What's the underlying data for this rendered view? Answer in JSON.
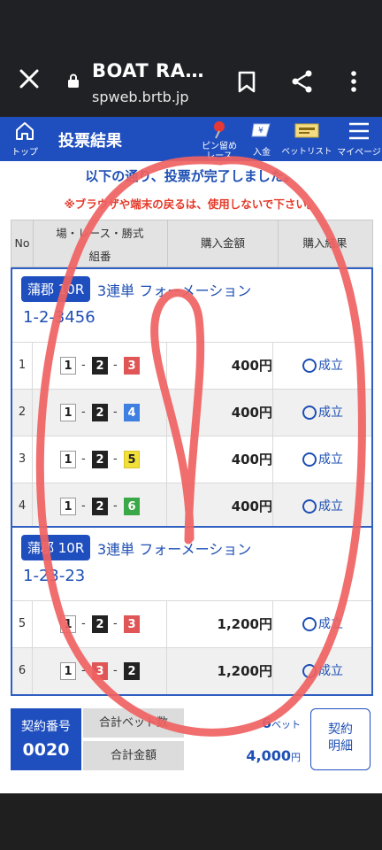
{
  "browser": {
    "title": "BOAT RA…",
    "url": "spweb.brtb.jp"
  },
  "nav": {
    "top_label": "トップ",
    "page_title": "投票結果",
    "pin_label_1": "ピン留め",
    "pin_label_2": "レース",
    "deposit_label": "入金",
    "betlist_label": "ベットリスト",
    "mypage_label": "マイページ"
  },
  "messages": {
    "complete": "以下の通り、投票が完了しました。",
    "warning": "※ブラウザや端末の戻るは、使用しないで下さい。"
  },
  "table_header": {
    "no": "No",
    "race": "場・レース・勝式",
    "combination": "組番",
    "amount": "購入金額",
    "result": "購入結果"
  },
  "groups": [
    {
      "venue": "蒲郡 10R",
      "kind": "3連単 フォーメーション",
      "combination": "1-2-3456",
      "rows": [
        {
          "no": "1",
          "boats": [
            "1",
            "2",
            "3"
          ],
          "amount": "400円",
          "result": "成立"
        },
        {
          "no": "2",
          "boats": [
            "1",
            "2",
            "4"
          ],
          "amount": "400円",
          "result": "成立"
        },
        {
          "no": "3",
          "boats": [
            "1",
            "2",
            "5"
          ],
          "amount": "400円",
          "result": "成立"
        },
        {
          "no": "4",
          "boats": [
            "1",
            "2",
            "6"
          ],
          "amount": "400円",
          "result": "成立"
        }
      ]
    },
    {
      "venue": "蒲郡 10R",
      "kind": "3連単 フォーメーション",
      "combination": "1-23-23",
      "rows": [
        {
          "no": "5",
          "boats": [
            "1",
            "2",
            "3"
          ],
          "amount": "1,200円",
          "result": "成立"
        },
        {
          "no": "6",
          "boats": [
            "1",
            "3",
            "2"
          ],
          "amount": "1,200円",
          "result": "成立"
        }
      ]
    }
  ],
  "footer": {
    "contract_label": "契約番号",
    "contract_no": "0020",
    "total_bets_label": "合計ベット数",
    "total_bets": "6",
    "bets_unit": "ベット",
    "total_amount_label": "合計金額",
    "total_amount": "4,000",
    "yen_unit": "円",
    "detail_line1": "契約",
    "detail_line2": "明細"
  },
  "colors": {
    "brand_blue": "#1f4fbf",
    "warning_red": "#e43a2a",
    "scribble_red": "#f06262"
  }
}
